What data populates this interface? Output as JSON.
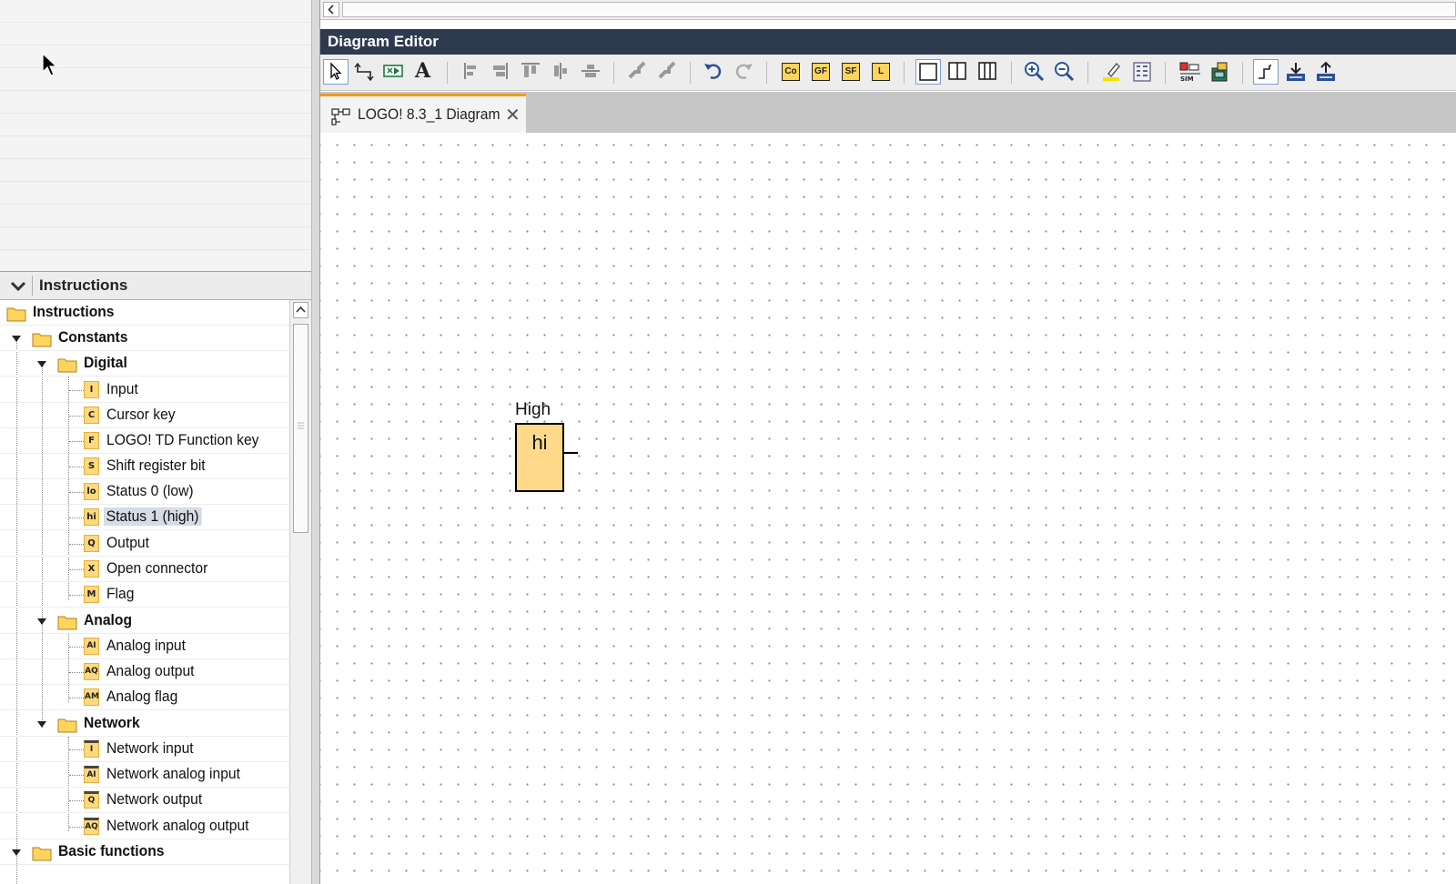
{
  "panel": {
    "header_title": "Instructions"
  },
  "tree": {
    "root": "Instructions",
    "constants": "Constants",
    "digital": "Digital",
    "digital_items": [
      {
        "code": "I",
        "label": "Input"
      },
      {
        "code": "C",
        "label": "Cursor key"
      },
      {
        "code": "F",
        "label": "LOGO! TD Function key"
      },
      {
        "code": "S",
        "label": "Shift register bit"
      },
      {
        "code": "lo",
        "label": "Status 0 (low)"
      },
      {
        "code": "hi",
        "label": "Status 1 (high)"
      },
      {
        "code": "Q",
        "label": "Output"
      },
      {
        "code": "X",
        "label": "Open connector"
      },
      {
        "code": "M",
        "label": "Flag"
      }
    ],
    "analog": "Analog",
    "analog_items": [
      {
        "code": "AI",
        "label": "Analog input"
      },
      {
        "code": "AQ",
        "label": "Analog output"
      },
      {
        "code": "AM",
        "label": "Analog flag"
      }
    ],
    "network": "Network",
    "network_items": [
      {
        "code": "I",
        "label": "Network input"
      },
      {
        "code": "AI",
        "label": "Network analog input"
      },
      {
        "code": "Q",
        "label": "Network output"
      },
      {
        "code": "AQ",
        "label": "Network analog output"
      }
    ],
    "basic": "Basic functions",
    "selected": "Status 1 (high)"
  },
  "editor": {
    "title": "Diagram Editor",
    "tab_label": "LOGO! 8.3_1 Diagram",
    "tab_close": "✕",
    "toolbar_text": {
      "co": "Co",
      "gf": "GF",
      "sf": "SF",
      "l": "L",
      "text_tool": "A"
    }
  },
  "diagram": {
    "block_label": "High",
    "block_text": "hi"
  },
  "colors": {
    "title_bar": "#2e3a4d",
    "tab_accent": "#f29b1d",
    "block_fill": "#ffd98a",
    "badge_fill": "#ffd97e",
    "selection": "#d5dce6"
  }
}
